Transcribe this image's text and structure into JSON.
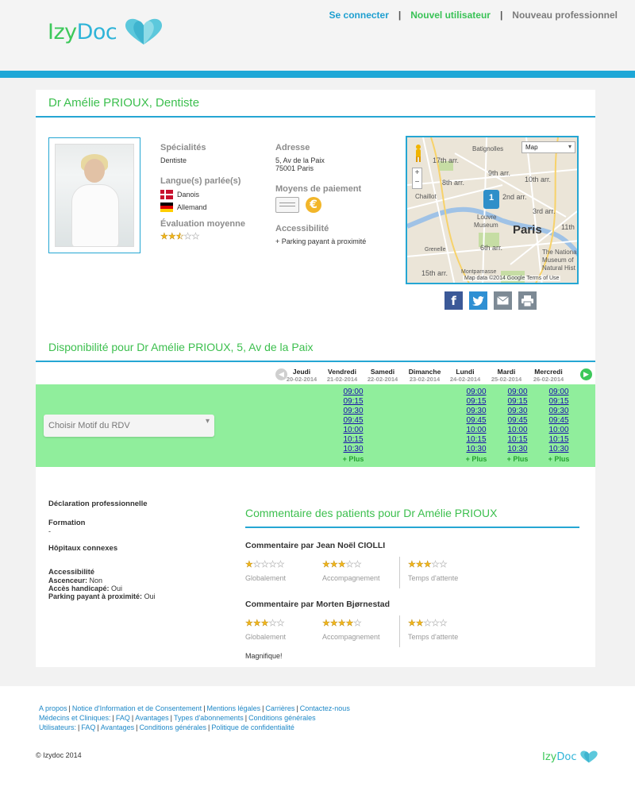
{
  "header": {
    "logo_izy": "Izy",
    "logo_doc": "Doc",
    "nav": {
      "login": "Se connecter",
      "new_user": "Nouvel utilisateur",
      "new_pro": "Nouveau professionnel"
    }
  },
  "doctor": {
    "title": "Dr Amélie PRIOUX, Dentiste",
    "specialties_label": "Spécialités",
    "specialty": "Dentiste",
    "languages_label": "Langue(s) parlée(s)",
    "languages": [
      "Danois",
      "Allemand"
    ],
    "rating_label": "Évaluation moyenne",
    "rating": 2.5,
    "address_label": "Adresse",
    "address_line1": "5, Av de la Paix",
    "address_line2": "75001 Paris",
    "payment_label": "Moyens de paiement",
    "payment_icons": [
      "cheque-icon",
      "euro-icon"
    ],
    "accessibility_label": "Accessibilité",
    "accessibility_value": "+ Parking payant à proximité"
  },
  "map": {
    "type_select": "Map",
    "city_label": "Paris",
    "marker": "1",
    "districts": [
      "Batignolles",
      "17th arr.",
      "9th arr.",
      "10th arr.",
      "8th arr.",
      "2nd arr.",
      "3rd arr.",
      "Louvre",
      "Museum",
      "6th arr.",
      "Grenelle",
      "Chaillot",
      "11th",
      "The Nationa",
      "Museum of",
      "Natural Hist",
      "Montparnasse",
      "15th arr."
    ],
    "attribution": "Map data ©2014 Google    Terms of Use"
  },
  "share": [
    "facebook-icon",
    "twitter-icon",
    "email-icon",
    "print-icon"
  ],
  "availability": {
    "title": "Disponibilité pour Dr Amélie PRIOUX, 5, Av de la Paix",
    "motif_placeholder": "Choisir Motif du RDV",
    "days": [
      {
        "name": "Jeudi",
        "date": "20-02-2014",
        "slots": [],
        "more": ""
      },
      {
        "name": "Vendredi",
        "date": "21-02-2014",
        "slots": [
          "09:00",
          "09:15",
          "09:30",
          "09:45",
          "10:00",
          "10:15",
          "10:30"
        ],
        "more": "+ Plus"
      },
      {
        "name": "Samedi",
        "date": "22-02-2014",
        "slots": [],
        "more": ""
      },
      {
        "name": "Dimanche",
        "date": "23-02-2014",
        "slots": [],
        "more": ""
      },
      {
        "name": "Lundi",
        "date": "24-02-2014",
        "slots": [
          "09:00",
          "09:15",
          "09:30",
          "09:45",
          "10:00",
          "10:15",
          "10:30"
        ],
        "more": "+ Plus"
      },
      {
        "name": "Mardi",
        "date": "25-02-2014",
        "slots": [
          "09:00",
          "09:15",
          "09:30",
          "09:45",
          "10:00",
          "10:15",
          "10:30"
        ],
        "more": "+ Plus"
      },
      {
        "name": "Mercredi",
        "date": "26-02-2014",
        "slots": [
          "09:00",
          "09:15",
          "09:30",
          "09:45",
          "10:00",
          "10:15",
          "10:30"
        ],
        "more": "+ Plus"
      }
    ]
  },
  "info": {
    "declaration": "Déclaration professionnelle",
    "formation": "Formation",
    "formation_value": "-",
    "hospitals": "Hôpitaux connexes",
    "accessibility": "Accessibilité",
    "lift_label": "Ascenceur:",
    "lift_value": "Non",
    "handicap_label": "Accès handicapé:",
    "handicap_value": "Oui",
    "parking_label": "Parking payant à proximité:",
    "parking_value": "Oui"
  },
  "comments": {
    "title": "Commentaire des patients pour Dr Amélie PRIOUX",
    "criteria": [
      "Globalement",
      "Accompagnement",
      "Temps d'attente"
    ],
    "items": [
      {
        "author": "Commentaire par Jean Noël CIOLLI",
        "ratings": [
          1,
          3,
          3
        ],
        "text": ""
      },
      {
        "author": "Commentaire par Morten Bjørnestad",
        "ratings": [
          3,
          4,
          2
        ],
        "text": "Magnifique!"
      }
    ]
  },
  "footer": {
    "row1": [
      "A propos",
      "Notice d'Information et de Consentement",
      "Mentions légales",
      "Carrières",
      "Contactez-nous"
    ],
    "row2": [
      "Médecins et Cliniques:",
      "FAQ",
      "Avantages",
      "Types d'abonnements",
      "Conditions générales"
    ],
    "row3": [
      "Utilisateurs:",
      "FAQ",
      "Avantages",
      "Conditions générales",
      "Politique de confidentialité"
    ],
    "copyright": "© Izydoc 2014",
    "logo_izy": "Izy",
    "logo_doc": "Doc"
  },
  "colors": {
    "accent_blue": "#1ea7d7",
    "accent_green": "#3cbf4e",
    "slot_background": "#90ee9c"
  }
}
